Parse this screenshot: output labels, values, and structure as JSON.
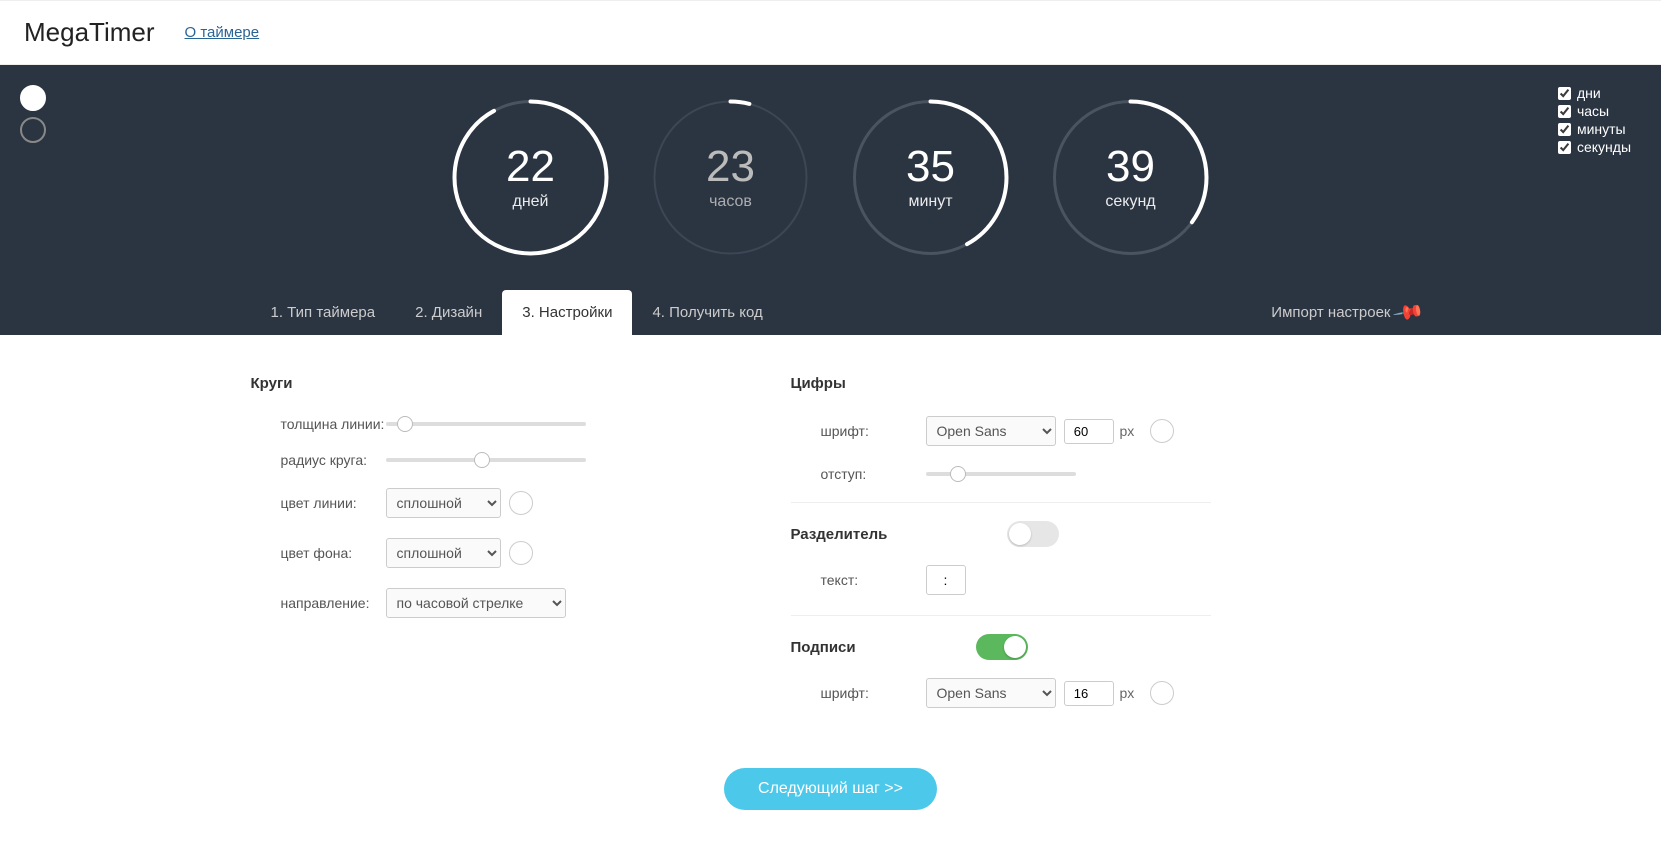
{
  "header": {
    "logo": "MegaTimer",
    "about": "О таймере"
  },
  "toggles": {
    "days": {
      "label": "дни",
      "checked": true
    },
    "hours": {
      "label": "часы",
      "checked": true
    },
    "minutes": {
      "label": "минуты",
      "checked": true
    },
    "seconds": {
      "label": "секунды",
      "checked": true
    }
  },
  "timer": {
    "days": {
      "value": "22",
      "label": "дней",
      "fraction": 0.92
    },
    "hours": {
      "value": "23",
      "label": "часов",
      "fraction": 0.04
    },
    "minutes": {
      "value": "35",
      "label": "минут",
      "fraction": 0.42
    },
    "seconds": {
      "value": "39",
      "label": "секунд",
      "fraction": 0.35
    }
  },
  "tabs": {
    "t1": "1. Тип таймера",
    "t2": "2. Дизайн",
    "t3": "3. Настройки",
    "t4": "4. Получить код",
    "import": "Импорт настроек"
  },
  "circles": {
    "title": "Круги",
    "lineWidthLabel": "толщина линии:",
    "radiusLabel": "радиус круга:",
    "lineColorLabel": "цвет линии:",
    "bgColorLabel": "цвет фона:",
    "directionLabel": "направление:",
    "solidOption": "сплошной",
    "directionOption": "по часовой стрелке"
  },
  "digits": {
    "title": "Цифры",
    "fontLabel": "шрифт:",
    "fontValue": "Open Sans",
    "fontSize": "60",
    "px": "px",
    "offsetLabel": "отступ:"
  },
  "separator": {
    "title": "Разделитель",
    "textLabel": "текст:",
    "textValue": ":",
    "enabled": false
  },
  "captions": {
    "title": "Подписи",
    "fontLabel": "шрифт:",
    "fontValue": "Open Sans",
    "fontSize": "16",
    "px": "px",
    "enabled": true
  },
  "footer": {
    "next": "Следующий шаг >>"
  }
}
